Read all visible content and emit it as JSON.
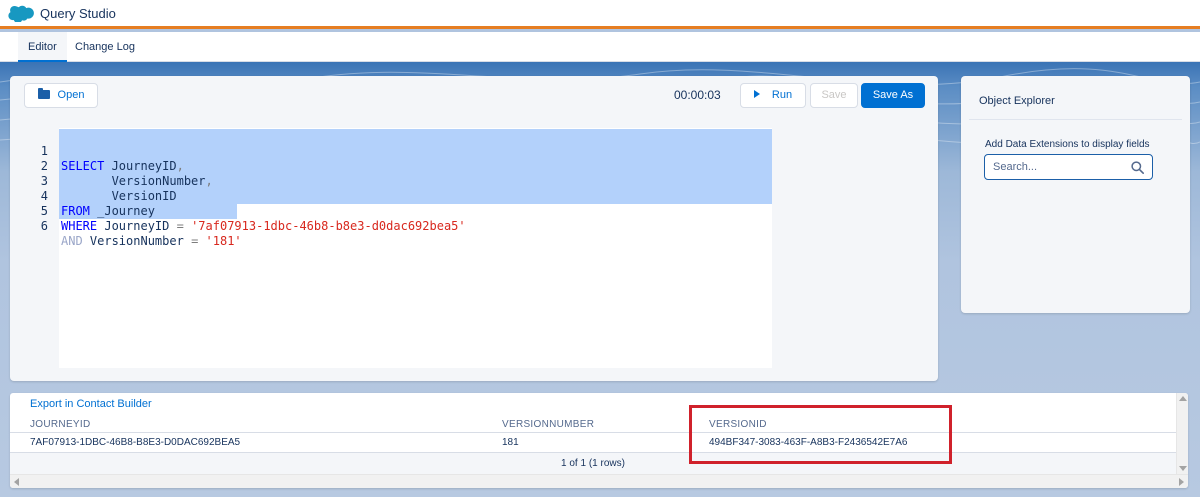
{
  "app": {
    "title": "Query Studio",
    "logo_icon": "salesforce-cloud-icon"
  },
  "tabs": [
    {
      "label": "Editor",
      "active": true
    },
    {
      "label": "Change Log",
      "active": false
    }
  ],
  "toolbar": {
    "open_label": "Open",
    "timer": "00:00:03",
    "run_label": "Run",
    "save_label": "Save",
    "save_as_label": "Save As"
  },
  "editor": {
    "line_numbers": [
      "1",
      "2",
      "3",
      "4",
      "5",
      "6"
    ],
    "lines": [
      {
        "kw": "SELECT",
        "text": " JourneyID",
        "punc": ","
      },
      {
        "kw": "",
        "text": "       VersionNumber",
        "punc": ","
      },
      {
        "kw": "",
        "text": "       VersionID",
        "punc": ""
      },
      {
        "kw": "FROM",
        "text": " _Journey",
        "punc": ""
      },
      {
        "kw": "WHERE",
        "text": " JourneyID ",
        "op": "=",
        "str": "'7af07913-1dbc-46b8-b8e3-d0dac692bea5'"
      },
      {
        "kw": "AND",
        "text": " VersionNumber ",
        "op": "=",
        "str": "'181'"
      }
    ]
  },
  "explorer": {
    "title": "Object Explorer",
    "hint": "Add Data Extensions to display fields",
    "search_placeholder": "Search..."
  },
  "results": {
    "export_label": "Export in Contact Builder",
    "columns": [
      "JOURNEYID",
      "VERSIONNUMBER",
      "VERSIONID"
    ],
    "rows": [
      [
        "7AF07913-1DBC-46B8-B8E3-D0DAC692BEA5",
        "181",
        "494BF347-3083-463F-A8B3-F2436542E7A6"
      ]
    ],
    "pager": "1 of 1 (1 rows)"
  },
  "colors": {
    "accent": "#0070d2",
    "header_border": "#e67e22",
    "highlight": "#d0212b",
    "selection": "#b3d1fb"
  }
}
